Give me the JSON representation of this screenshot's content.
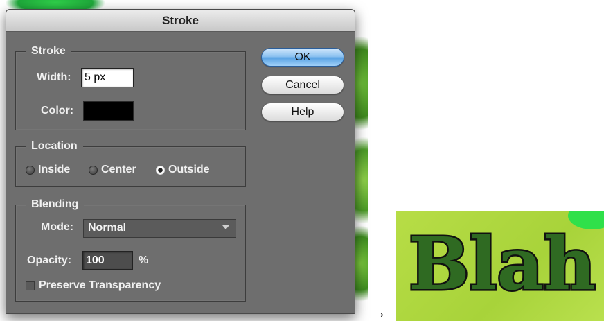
{
  "dialog": {
    "title": "Stroke",
    "stroke_group": {
      "legend": "Stroke",
      "width_label": "Width:",
      "width_value": "5 px",
      "color_label": "Color:",
      "color_value": "#000000"
    },
    "location_group": {
      "legend": "Location",
      "options": [
        {
          "label": "Inside",
          "selected": false
        },
        {
          "label": "Center",
          "selected": false
        },
        {
          "label": "Outside",
          "selected": true
        }
      ]
    },
    "blending_group": {
      "legend": "Blending",
      "mode_label": "Mode:",
      "mode_value": "Normal",
      "opacity_label": "Opacity:",
      "opacity_value": "100",
      "opacity_unit": "%",
      "preserve_label": "Preserve Transparency",
      "preserve_checked": false
    },
    "buttons": {
      "ok": "OK",
      "cancel": "Cancel",
      "help": "Help"
    }
  },
  "arrow": "→",
  "result_text": "Blah"
}
